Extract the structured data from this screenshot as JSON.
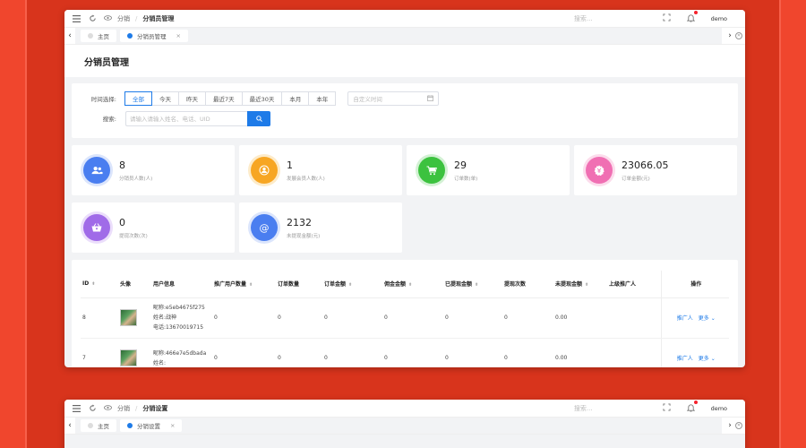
{
  "window1": {
    "breadcrumb": {
      "parent": "分销",
      "current": "分销员管理"
    },
    "search_placeholder": "搜索...",
    "user": "demo",
    "tabs": [
      {
        "label": "主页",
        "active": false
      },
      {
        "label": "分销员管理",
        "active": true
      }
    ],
    "page_title": "分销员管理",
    "filter": {
      "time_label": "时间选择:",
      "time_options": [
        "全部",
        "今天",
        "昨天",
        "最近7天",
        "最近30天",
        "本月",
        "本年"
      ],
      "selected": "全部",
      "date_placeholder": "自定义时间",
      "search_label": "搜索:",
      "search_placeholder": "请输入请输入姓名、电话、UID"
    },
    "stats": [
      {
        "value": "8",
        "label": "分销员人数(人)",
        "color": "#4a7ef0",
        "icon": "users-icon"
      },
      {
        "value": "1",
        "label": "发展会员人数(人)",
        "color": "#f7a623",
        "icon": "user-icon"
      },
      {
        "value": "29",
        "label": "订单数(单)",
        "color": "#3cc23f",
        "icon": "cart-icon"
      },
      {
        "value": "23066.05",
        "label": "订单金额(元)",
        "color": "#f06fb3",
        "icon": "money-icon"
      },
      {
        "value": "0",
        "label": "提现次数(次)",
        "color": "#a06be8",
        "icon": "basket-icon"
      },
      {
        "value": "2132",
        "label": "未提现金额(元)",
        "color": "#4a7ef0",
        "icon": "at-icon"
      }
    ],
    "table": {
      "headers": [
        "ID",
        "头像",
        "用户信息",
        "推广用户数量",
        "订单数量",
        "订单金额",
        "佣金金额",
        "已提现金额",
        "提现次数",
        "未提现金额",
        "上级推广人",
        "操作"
      ],
      "sortable": [
        true,
        false,
        false,
        true,
        false,
        true,
        true,
        true,
        false,
        true,
        false,
        false
      ],
      "rows": [
        {
          "id": "8",
          "nickname": "昵称:e5eb4675f275",
          "name": "姓名:战神",
          "phone": "电话:13670019715",
          "promo": "0",
          "orders": "0",
          "amount": "0",
          "commission": "0",
          "withdrawn": "0",
          "count": "0",
          "unwithdrawn": "0.00",
          "superior": "",
          "op": "推广人",
          "more": "更多"
        },
        {
          "id": "7",
          "nickname": "昵称:466e7e5dbada",
          "name": "姓名:",
          "phone": "",
          "promo": "0",
          "orders": "0",
          "amount": "0",
          "commission": "0",
          "withdrawn": "0",
          "count": "0",
          "unwithdrawn": "0.00",
          "superior": "",
          "op": "推广人",
          "more": "更多"
        }
      ]
    }
  },
  "window2": {
    "breadcrumb": {
      "parent": "分销",
      "current": "分销设置"
    },
    "search_placeholder": "搜索...",
    "user": "demo",
    "tabs": [
      {
        "label": "主页",
        "active": false
      },
      {
        "label": "分销设置",
        "active": true
      }
    ]
  }
}
